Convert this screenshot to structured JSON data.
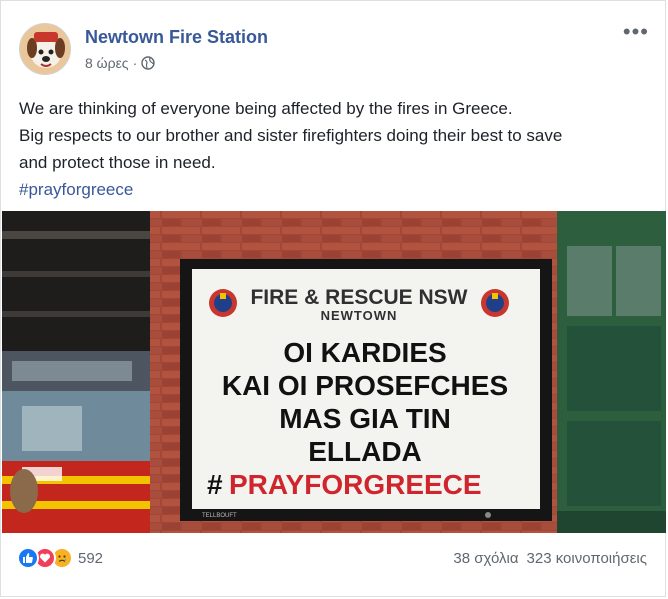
{
  "post": {
    "page_name": "Newtown Fire Station",
    "time": "8 ώρες",
    "separator": "·",
    "privacy_icon": "globe-icon",
    "more_label": "•••",
    "text_lines": [
      "We are thinking of everyone being affected by the fires in Greece.",
      "Big respects to our brother and sister firefighters doing their best to save",
      "and protect those in need."
    ],
    "hashtag": "#prayforgreece"
  },
  "photo": {
    "sign_title": "FIRE & RESCUE NSW",
    "sign_subtitle": "NEWTOWN",
    "sign_lines": [
      "OI KARDIES",
      "KAI OI PROSEFCHES",
      "MAS GIA TIN",
      "ELLADA"
    ],
    "sign_hashtag_symbol": "#",
    "sign_hashtag_text": "PRAYFORGREECE",
    "sign_brand": "TELLBOUFT",
    "colors": {
      "brick": "#a1473a",
      "sign_red": "#d0252d",
      "door_green": "#2d5e3d"
    }
  },
  "footer": {
    "reaction_icons": [
      "like-icon",
      "love-icon",
      "sad-icon"
    ],
    "reaction_count": "592",
    "comments": "38 σχόλια",
    "shares": "323 κοινοποιήσεις"
  },
  "colors": {
    "link": "#385898",
    "text": "#1d2129",
    "muted": "#606770"
  }
}
